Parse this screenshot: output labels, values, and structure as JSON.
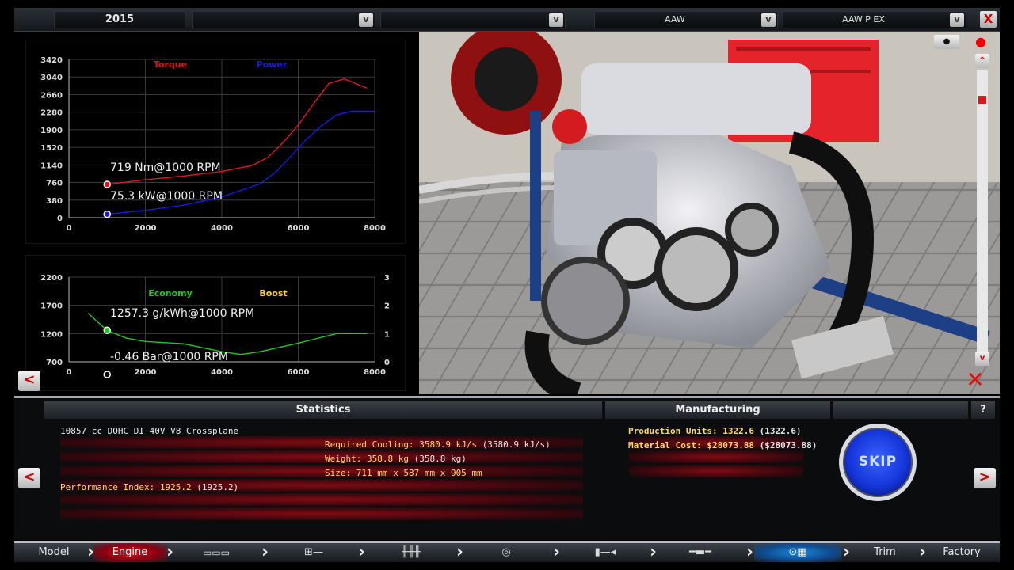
{
  "topbar": {
    "year": "2015",
    "field2": "",
    "field3": "",
    "family": "AAW",
    "variant": "AAW P EX",
    "dropdown_glyph": "v",
    "close_glyph": "X"
  },
  "chart_data": [
    {
      "type": "line",
      "series": [
        {
          "name": "Torque",
          "color": "#e0141c",
          "x": [
            1000,
            2000,
            3000,
            4000,
            4800,
            5200,
            5600,
            6000,
            6400,
            6800,
            7200,
            7800
          ],
          "y": [
            719,
            820,
            900,
            1000,
            1130,
            1300,
            1620,
            2000,
            2460,
            2900,
            3000,
            2800
          ]
        },
        {
          "name": "Power",
          "color": "#1818e0",
          "x": [
            1000,
            2000,
            3000,
            4000,
            5000,
            5400,
            5800,
            6200,
            6600,
            7000,
            7400,
            8000
          ],
          "y": [
            75,
            160,
            270,
            450,
            730,
            980,
            1320,
            1680,
            1980,
            2220,
            2300,
            2300
          ]
        }
      ],
      "yticks": [
        "3420",
        "3040",
        "2660",
        "2280",
        "1900",
        "1520",
        "1140",
        "760",
        "380",
        "0"
      ],
      "xticks": [
        "0",
        "2000",
        "4000",
        "6000",
        "8000"
      ],
      "xlim": [
        0,
        8000
      ],
      "ylim": [
        0,
        3420
      ],
      "annotations": [
        "719 Nm@1000 RPM",
        "75.3 kW@1000 RPM"
      ],
      "grid": true
    },
    {
      "type": "line",
      "series": [
        {
          "name": "Economy",
          "color": "#22c822",
          "x": [
            500,
            1000,
            1500,
            2000,
            3000,
            4000,
            4500,
            5000,
            6000,
            7000,
            7800
          ],
          "y": [
            1560,
            1257,
            1120,
            1060,
            1020,
            880,
            830,
            880,
            1030,
            1200,
            1200
          ]
        },
        {
          "name": "Boost",
          "color": "#ffd040",
          "x": [],
          "y": []
        }
      ],
      "yticks": [
        "2200",
        "1700",
        "1200",
        "700"
      ],
      "y2ticks": [
        "3",
        "2",
        "1",
        "0"
      ],
      "xticks": [
        "0",
        "2000",
        "4000",
        "6000",
        "8000"
      ],
      "xlim": [
        0,
        8000
      ],
      "ylim": [
        700,
        2200
      ],
      "y2lim": [
        0,
        3
      ],
      "annotations": [
        "1257.3 g/kWh@1000 RPM",
        "-0.46 Bar@1000 RPM"
      ],
      "grid": true
    }
  ],
  "stats": {
    "header": "Statistics",
    "engine_name": "10857 cc DOHC DI 40V V8 Crossplane",
    "required_cooling": "Required Cooling: 3580.9 kJ/s",
    "required_cooling_sub": "(3580.9 kJ/s)",
    "weight": "Weight: 358.8 kg",
    "weight_sub": "(358.8 kg)",
    "size": "Size: 711 mm x 587 mm x 905 mm",
    "performance": "Performance Index: 1925.2",
    "performance_sub": "(1925.2)"
  },
  "manufacturing": {
    "header": "Manufacturing",
    "production": "Production Units: 1322.6",
    "production_sub": "(1322.6)",
    "material": "Material Cost: $28073.88",
    "material_sub": "($28073.88)"
  },
  "buttons": {
    "skip": "SKIP",
    "help": "?",
    "left": "<",
    "right": ">",
    "up": "^",
    "down": "v"
  },
  "nav": {
    "model": "Model",
    "engine": "Engine",
    "trim": "Trim",
    "factory": "Factory",
    "sep": "›"
  },
  "colors": {
    "accent_red": "#d01020",
    "accent_blue": "#1434d8",
    "stat_text": "#ffd76b"
  }
}
